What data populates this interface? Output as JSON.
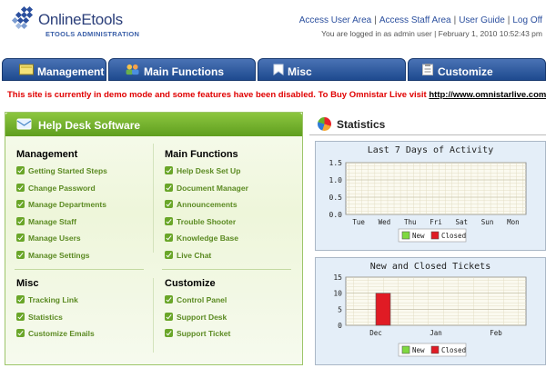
{
  "header": {
    "logo_title": "OnlineEtools",
    "logo_subtitle": "ETOOLS ADMINISTRATION",
    "links": [
      "Access User Area",
      "Access Staff Area",
      "User Guide",
      "Log Off"
    ],
    "login_info": "You are logged in as admin user | February 1, 2010 10:52:43 pm"
  },
  "tabs": [
    {
      "label": "Management",
      "icon": "folder-icon"
    },
    {
      "label": "Main Functions",
      "icon": "users-icon"
    },
    {
      "label": "Misc",
      "icon": "bookmark-icon"
    },
    {
      "label": "Customize",
      "icon": "clipboard-icon"
    }
  ],
  "notice": {
    "text": "This site is currently in demo mode and some features have been disabled. To Buy Omnistar Live visit",
    "link": "http://www.omnistarlive.com",
    "suffix": "."
  },
  "helpdesk": {
    "title": "Help Desk Software",
    "sections": [
      {
        "title": "Management",
        "items": [
          "Getting Started Steps",
          "Change Password",
          "Manage Departments",
          "Manage Staff",
          "Manage Users",
          "Manage Settings"
        ]
      },
      {
        "title": "Main Functions",
        "items": [
          "Help Desk Set Up",
          "Document Manager",
          "Announcements",
          "Trouble Shooter",
          "Knowledge Base",
          "Live Chat"
        ]
      },
      {
        "title": "Misc",
        "items": [
          "Tracking Link",
          "Statistics",
          "Customize Emails"
        ]
      },
      {
        "title": "Customize",
        "items": [
          "Control Panel",
          "Support Desk",
          "Support Ticket"
        ]
      }
    ]
  },
  "statistics": {
    "title": "Statistics"
  },
  "colors": {
    "accent": "#1e4a8f",
    "green": "#6aa629",
    "closed": "#e01b24",
    "new": "#7fd93f",
    "notice": "#e00000"
  },
  "chart_data": [
    {
      "type": "bar",
      "title": "Last 7 Days of Activity",
      "categories": [
        "Tue",
        "Wed",
        "Thu",
        "Fri",
        "Sat",
        "Sun",
        "Mon"
      ],
      "series": [
        {
          "name": "New",
          "values": [
            0,
            0,
            0,
            0,
            0,
            0,
            0
          ]
        },
        {
          "name": "Closed",
          "values": [
            0,
            0,
            0,
            0,
            0,
            0,
            0
          ]
        }
      ],
      "yticks": [
        "0.0",
        "0.5",
        "1.0",
        "1.5"
      ],
      "ylim": [
        0,
        1.5
      ],
      "legend": "bottom",
      "grid": true
    },
    {
      "type": "bar",
      "title": "New and Closed Tickets",
      "categories": [
        "Dec",
        "Jan",
        "Feb"
      ],
      "series": [
        {
          "name": "New",
          "values": [
            0,
            0,
            0
          ]
        },
        {
          "name": "Closed",
          "values": [
            10,
            0,
            0
          ]
        }
      ],
      "yticks": [
        "0",
        "5",
        "10",
        "15"
      ],
      "ylim": [
        0,
        15
      ],
      "legend": "bottom",
      "grid": true
    }
  ]
}
